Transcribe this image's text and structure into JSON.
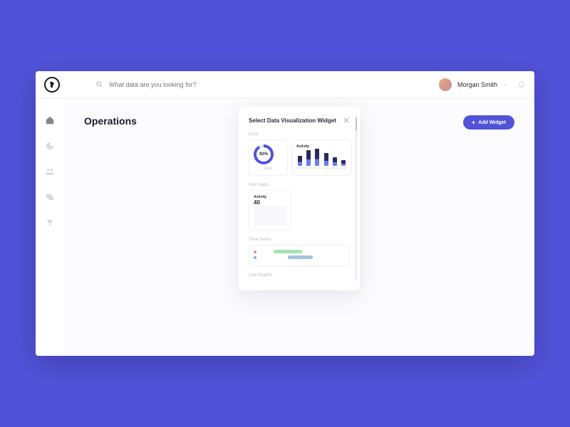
{
  "header": {
    "search_placeholder": "What data are you looking for?",
    "user_name": "Morgan Smith"
  },
  "page": {
    "title": "Operations",
    "add_widget_label": "Add Widget"
  },
  "modal": {
    "title": "Select Data Visualization Widget",
    "sections": {
      "card": "Card",
      "geomap": "Geo maps",
      "timeseries": "Time Series",
      "linegraph": "Line Graphs"
    }
  },
  "widgets": {
    "gauge": {
      "value": "92%",
      "label": "Goal"
    },
    "barchart": {
      "title": "Activity"
    },
    "geomap": {
      "title": "Activity",
      "metric": "40"
    }
  },
  "chart_data": {
    "type": "bar",
    "title": "Activity",
    "categories": [
      "Week1",
      "Week2",
      "Week3",
      "Week4",
      "Week5",
      "Week6"
    ],
    "values": [
      14,
      22,
      24,
      18,
      12,
      8
    ],
    "ylim": [
      0,
      26
    ]
  }
}
